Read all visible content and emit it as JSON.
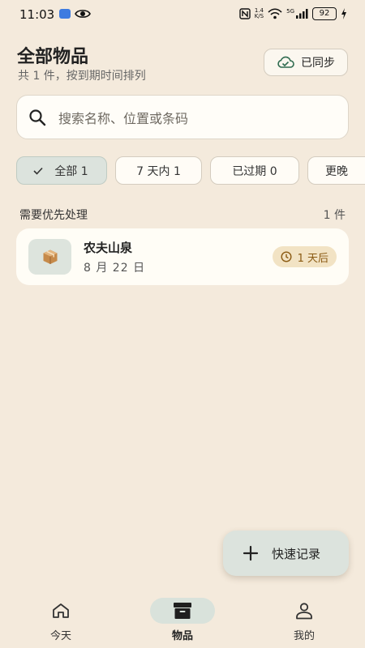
{
  "status_bar": {
    "time": "11:03",
    "net_speed_value": "1.4",
    "net_speed_unit": "K/S",
    "network": "5G",
    "battery": "92"
  },
  "header": {
    "title": "全部物品",
    "subtitle": "共 1 件，按到期时间排列",
    "sync_label": "已同步"
  },
  "search": {
    "placeholder": "搜索名称、位置或条码"
  },
  "filters": [
    {
      "label": "全部 1",
      "active": true
    },
    {
      "label": "7 天内 1",
      "active": false
    },
    {
      "label": "已过期 0",
      "active": false
    },
    {
      "label": "更晚",
      "active": false
    }
  ],
  "section": {
    "title": "需要优先处理",
    "count": "1 件"
  },
  "items": [
    {
      "name": "农夫山泉",
      "date": "8 月 22 日",
      "badge": "1 天后",
      "icon": "box-icon"
    }
  ],
  "fab": {
    "label": "快速记录"
  },
  "nav": [
    {
      "label": "今天",
      "icon": "home-icon",
      "active": false
    },
    {
      "label": "物品",
      "icon": "archive-icon",
      "active": true
    },
    {
      "label": "我的",
      "icon": "person-icon",
      "active": false
    }
  ],
  "colors": {
    "background": "#F4EADC",
    "card": "#FFFDF6",
    "accent_green": "#DCE3DD",
    "sync_icon": "#2F6B4F",
    "badge_bg": "#F2E3C4",
    "badge_text": "#8A5A12"
  }
}
